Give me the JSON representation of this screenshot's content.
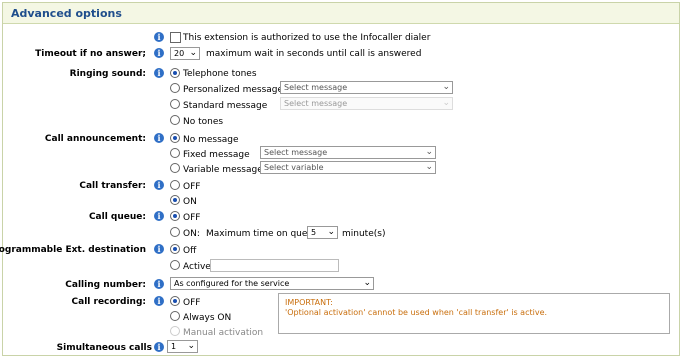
{
  "header": {
    "title": "Advanced options"
  },
  "infocaller": {
    "label": "This extension is authorized to use the Infocaller dialer",
    "checked": false
  },
  "timeout": {
    "label": "Timeout if no answer;",
    "value": "20",
    "hint": "maximum wait in seconds until call is answered"
  },
  "ringing": {
    "label": "Ringing sound:",
    "options": [
      "Telephone tones",
      "Personalized message",
      "Standard message",
      "No tones"
    ],
    "selected": "Telephone tones",
    "personalized_select": "Select message",
    "standard_select": "Select message"
  },
  "announcement": {
    "label": "Call announcement:",
    "options": [
      "No message",
      "Fixed message",
      "Variable message"
    ],
    "selected": "No message",
    "fixed_select": "Select message",
    "variable_select": "Select variable"
  },
  "transfer": {
    "label": "Call transfer:",
    "options": [
      "OFF",
      "ON"
    ],
    "selected": "ON"
  },
  "queue": {
    "label": "Call queue:",
    "options": [
      "OFF",
      "ON:"
    ],
    "selected": "OFF",
    "max_time_label": "Maximum time on queue",
    "max_time_value": "5",
    "unit": "minute(s)"
  },
  "prog_ext": {
    "label": "Programmable Ext. destination",
    "options": [
      "Off",
      "Active"
    ],
    "selected": "Off",
    "active_value": ""
  },
  "calling_number": {
    "label": "Calling number:",
    "value": "As configured for the service"
  },
  "recording": {
    "label": "Call recording:",
    "options": [
      "OFF",
      "Always ON",
      "Manual activation"
    ],
    "selected": "OFF",
    "note_title": "IMPORTANT:",
    "note_text": "'Optional activation' cannot be used when 'call transfer' is active."
  },
  "simultaneous": {
    "label": "Simultaneous calls",
    "value": "1"
  },
  "colors": {
    "accent": "#1f4e8c",
    "info": "#2f6fc6",
    "note": "#c96f0e",
    "header_bg": "#f4f7e4"
  }
}
